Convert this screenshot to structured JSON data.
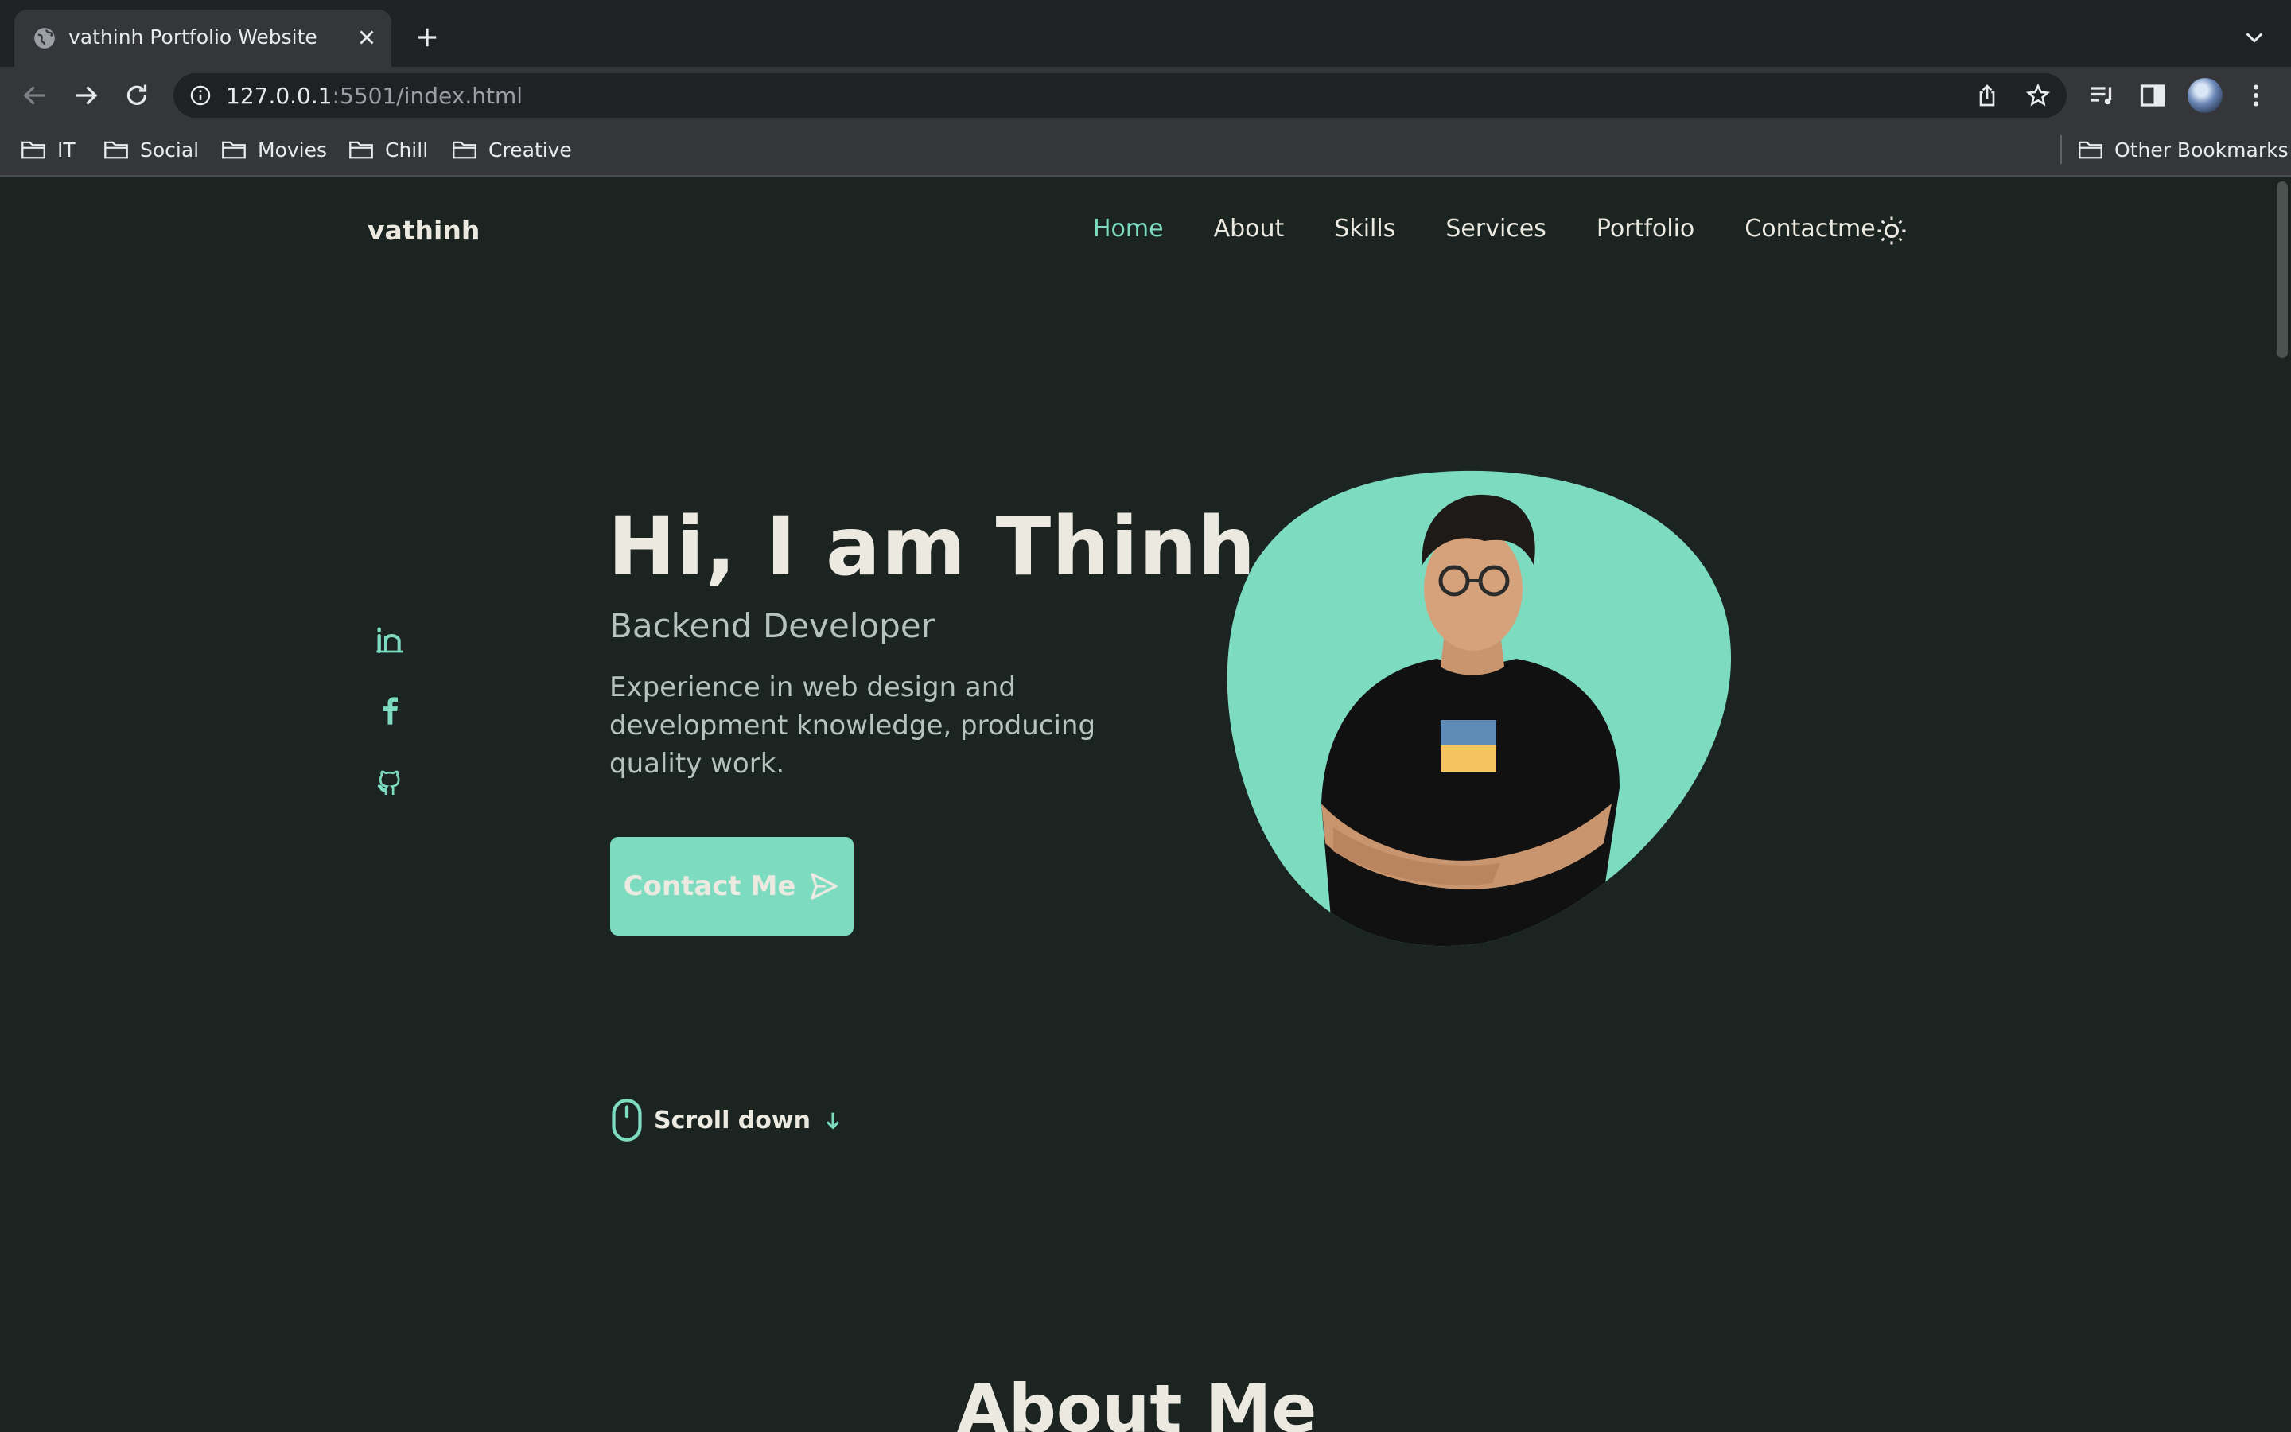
{
  "browser": {
    "tab_title": "vathinh Portfolio Website",
    "url_host": "127.0.0.1",
    "url_rest": ":5501/index.html",
    "bookmarks": [
      "IT",
      "Social",
      "Movies",
      "Chill",
      "Creative"
    ],
    "other_bookmarks": "Other Bookmarks"
  },
  "site": {
    "logo": "vathinh",
    "nav": [
      "Home",
      "About",
      "Skills",
      "Services",
      "Portfolio",
      "Contactme"
    ],
    "active_nav": "Home"
  },
  "hero": {
    "title": "Hi, I am Thinh",
    "subtitle": "Backend Developer",
    "description": "Experience in web design and development knowledge, producing quality work.",
    "button_label": "Contact Me",
    "scroll_label": "Scroll down",
    "social_icons": [
      "linkedin-icon",
      "facebook-icon",
      "github-icon"
    ]
  },
  "about": {
    "title": "About Me"
  },
  "colors": {
    "accent": "#7ddcc0",
    "background": "#1b2421",
    "text": "#ece9e1"
  }
}
